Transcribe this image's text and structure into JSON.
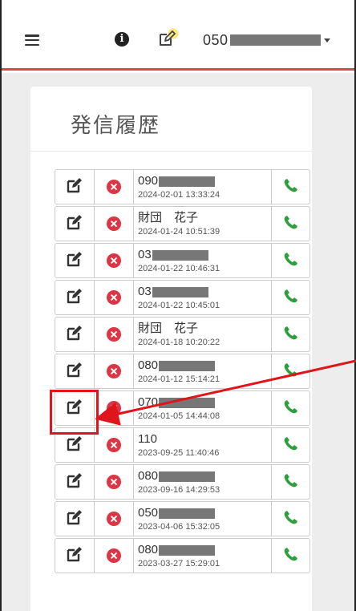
{
  "nav": {
    "menu_icon": "hamburger-icon",
    "info_icon": "info-circle-icon",
    "info_glyph": "i",
    "edit_icon": "pencil-square-icon",
    "phone_prefix": "050",
    "dropdown_icon": "caret-down-icon"
  },
  "page": {
    "title": "発信履歴"
  },
  "history": [
    {
      "name": "090",
      "masked": true,
      "time": "2024-02-01 13:33:24"
    },
    {
      "name": "財団　花子",
      "masked": false,
      "time": "2024-01-24 10:51:39"
    },
    {
      "name": "03",
      "masked": true,
      "time": "2024-01-22 10:46:31"
    },
    {
      "name": "03",
      "masked": true,
      "time": "2024-01-22 10:45:01"
    },
    {
      "name": "財団　花子",
      "masked": false,
      "time": "2024-01-18 10:20:22"
    },
    {
      "name": "080",
      "masked": true,
      "time": "2024-01-12 15:14:21"
    },
    {
      "name": "070",
      "masked": true,
      "time": "2024-01-05 14:44:08"
    },
    {
      "name": "110",
      "masked": false,
      "time": "2023-09-25 11:40:46"
    },
    {
      "name": "080",
      "masked": true,
      "time": "2023-09-16 14:29:53"
    },
    {
      "name": "050",
      "masked": true,
      "time": "2023-04-06 15:32:05"
    },
    {
      "name": "080",
      "masked": true,
      "time": "2023-03-27 15:29:01"
    }
  ],
  "row_icons": {
    "edit": "pencil-square-icon",
    "delete": "delete-circle-icon",
    "call": "phone-icon"
  },
  "colors": {
    "nav_border": "#d94848",
    "delete": "#dc3545",
    "call": "#2e9e3e",
    "annotation": "#e0141b"
  }
}
